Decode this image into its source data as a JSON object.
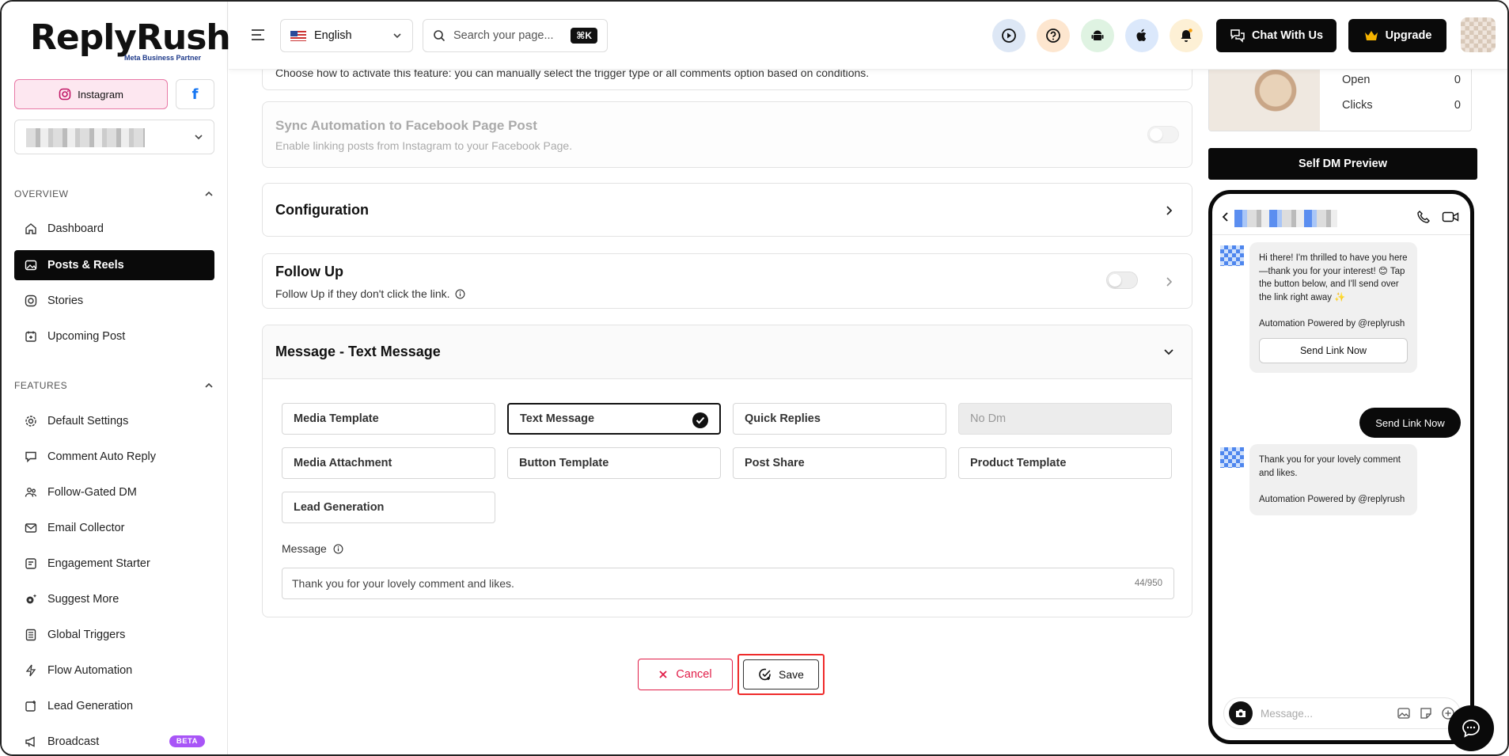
{
  "brand": {
    "name": "ReplyRush",
    "partner": "Meta Business Partner"
  },
  "accounts": {
    "instagram_label": "Instagram",
    "facebook_label": "f"
  },
  "sidebar": {
    "overview_title": "OVERVIEW",
    "overview_items": [
      {
        "label": "Dashboard",
        "icon": "home-icon"
      },
      {
        "label": "Posts & Reels",
        "icon": "image-icon",
        "active": true
      },
      {
        "label": "Stories",
        "icon": "instagram-icon"
      },
      {
        "label": "Upcoming Post",
        "icon": "calendar-icon"
      }
    ],
    "features_title": "FEATURES",
    "features_items": [
      {
        "label": "Default Settings",
        "icon": "gear-icon"
      },
      {
        "label": "Comment Auto Reply",
        "icon": "comment-icon"
      },
      {
        "label": "Follow-Gated DM",
        "icon": "users-icon"
      },
      {
        "label": "Email Collector",
        "icon": "mail-icon"
      },
      {
        "label": "Engagement Starter",
        "icon": "engagement-icon"
      },
      {
        "label": "Suggest More",
        "icon": "cog-sparkle-icon"
      },
      {
        "label": "Global Triggers",
        "icon": "list-icon"
      },
      {
        "label": "Flow Automation",
        "icon": "bolt-icon"
      },
      {
        "label": "Lead Generation",
        "icon": "lead-icon"
      },
      {
        "label": "Broadcast",
        "icon": "megaphone-icon",
        "badge": "BETA"
      }
    ]
  },
  "header": {
    "language": "English",
    "search_placeholder": "Search your page...",
    "search_shortcut": "⌘K",
    "chat_label": "Chat With Us",
    "upgrade_label": "Upgrade",
    "icon_colors": {
      "play": "#dde7f5",
      "help": "#fde6cf",
      "android": "#dff3e2",
      "apple": "#dbe8fb",
      "bell": "#fdf0d5"
    }
  },
  "main": {
    "partial_text": "Choose how to activate this feature: you can manually select the trigger type or all comments option based on conditions.",
    "sync": {
      "title": "Sync Automation to Facebook Page Post",
      "desc": "Enable linking posts from Instagram to your Facebook Page."
    },
    "configuration": "Configuration",
    "follow_up": {
      "title": "Follow Up",
      "desc": "Follow Up if they don't click the link."
    },
    "message_section": {
      "title": "Message - Text Message",
      "options": [
        "Media Template",
        "Text Message",
        "Quick Replies",
        "No Dm",
        "Media Attachment",
        "Button Template",
        "Post Share",
        "Product Template",
        "Lead Generation"
      ],
      "selected": "Text Message",
      "message_label": "Message",
      "message_value": "Thank you for your lovely comment and likes.",
      "counter": "44/950"
    },
    "cancel_label": "Cancel",
    "save_label": "Save"
  },
  "right": {
    "stats": [
      {
        "label": "Open",
        "value": "0"
      },
      {
        "label": "Clicks",
        "value": "0"
      }
    ],
    "preview_title": "Self DM Preview",
    "bubble1": "Hi there! I'm thrilled to have you here—thank you for your interest! 😊 Tap the button below, and I'll send over the link right away ✨\n\nAutomation Powered by @replyrush",
    "bubble1_button": "Send Link Now",
    "sent_message": "Send Link Now",
    "bubble2": "Thank you for your lovely comment and likes.\n\nAutomation Powered by @replyrush",
    "input_placeholder": "Message..."
  }
}
